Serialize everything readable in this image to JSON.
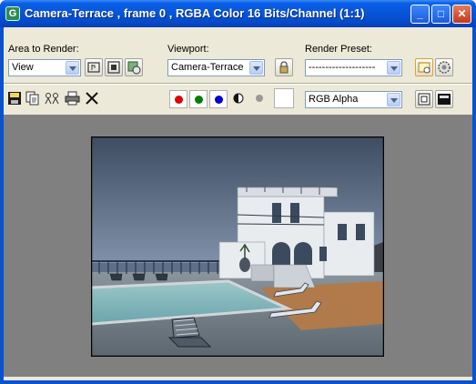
{
  "window": {
    "title": "Camera-Terrace , frame 0 , RGBA Color 16 Bits/Channel (1:1)",
    "app_icon_glyph": "G",
    "minimize_glyph": "_",
    "maximize_glyph": "□",
    "close_glyph": "✕"
  },
  "toolbar": {
    "area_to_render_label": "Area to Render:",
    "area_to_render_value": "View",
    "viewport_label": "Viewport:",
    "viewport_value": "Camera-Terrace",
    "render_preset_label": "Render Preset:",
    "render_preset_value": "--------------------",
    "channel_display_value": "RGB Alpha"
  },
  "icons": {
    "save": "save-icon",
    "copy": "copy-icon",
    "clone": "clone-icon",
    "print": "print-icon",
    "clear": "clear-icon",
    "edit_region": "edit-region-icon",
    "auto_region": "auto-region-icon",
    "render_setup": "render-setup-icon",
    "lock": "lock-icon",
    "environment": "environment-icon",
    "render_settings": "gear-icon",
    "monochrome": "monochrome-icon",
    "single_channel": "single-channel-icon",
    "toggle_ui": "toggle-ui-icon",
    "toggle_overlay": "toggle-overlay-icon"
  },
  "colors": {
    "red_channel": "#e00000",
    "green_channel": "#008000",
    "blue_channel": "#0000d0",
    "title_bar": "#0a52cf",
    "viewport_background": "#808080"
  }
}
